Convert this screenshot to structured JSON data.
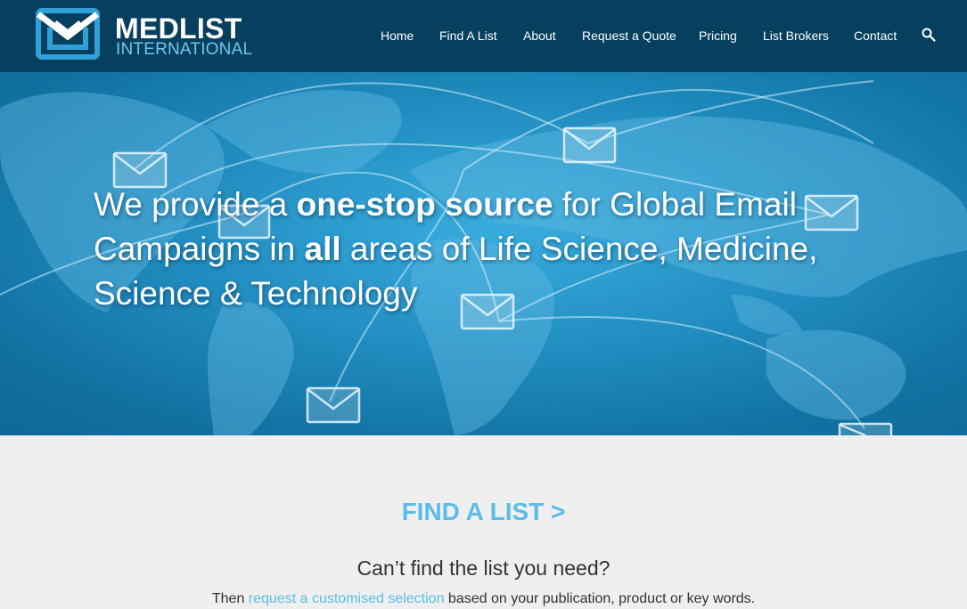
{
  "brand": {
    "name": "MEDLIST",
    "subtitle": "INTERNATIONAL"
  },
  "nav": {
    "items": [
      {
        "label": "Home"
      },
      {
        "label": "Find A List"
      },
      {
        "label": "About"
      },
      {
        "label": "Request a Quote"
      },
      {
        "label": "Pricing"
      },
      {
        "label": "List Brokers"
      },
      {
        "label": "Contact"
      }
    ],
    "search_icon": "search-icon"
  },
  "hero": {
    "part1": "We provide a ",
    "bold1": "one-stop source",
    "part2": " for Global Email Campaigns in ",
    "bold2": "all",
    "part3": " areas of Life Science, Medicine, Science & Technology",
    "background": "world-map-with-email-envelopes"
  },
  "find": {
    "title": "FIND A LIST >",
    "subtitle": "Can’t find the list you need?",
    "then_prefix": "Then ",
    "then_link": "request a customised selection",
    "then_suffix": " based on your publication, product or key words."
  },
  "colors": {
    "header_bg": "#07405f",
    "accent": "#5bbde7",
    "logo_sub": "#6ec6ee",
    "hero_blue": "#1a8cc4",
    "section_bg": "#efefef"
  }
}
